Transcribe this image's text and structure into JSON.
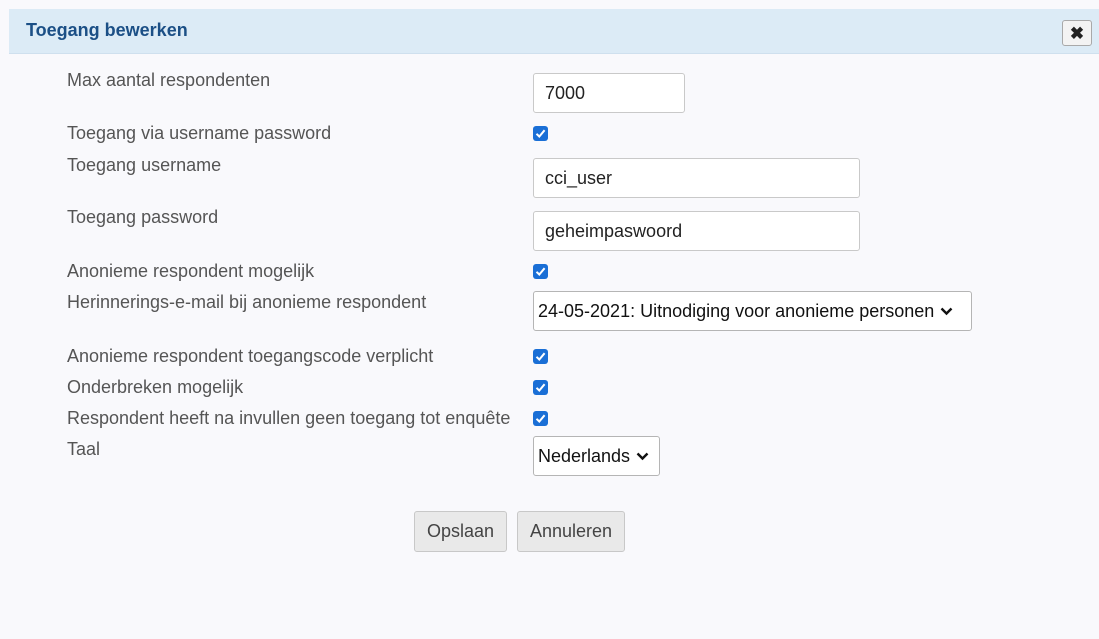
{
  "dialog": {
    "title": "Toegang bewerken",
    "close_icon": "close-icon"
  },
  "fields": {
    "max_respondents": {
      "label": "Max aantal respondenten",
      "value": "7000"
    },
    "access_userpass": {
      "label": "Toegang via username password",
      "checked": true
    },
    "username": {
      "label": "Toegang username",
      "value": "cci_user"
    },
    "password": {
      "label": "Toegang password",
      "value": "geheimpaswoord"
    },
    "anonymous_possible": {
      "label": "Anonieme respondent mogelijk",
      "checked": true
    },
    "reminder_email": {
      "label": "Herinnerings-e-mail bij anonieme respondent",
      "selected": "24-05-2021: Uitnodiging voor anonieme personen"
    },
    "anonymous_code_required": {
      "label": "Anonieme respondent toegangscode verplicht",
      "checked": true
    },
    "interrupt_possible": {
      "label": "Onderbreken mogelijk",
      "checked": true
    },
    "no_access_after": {
      "label": "Respondent heeft na invullen geen toegang tot enquête",
      "checked": true
    },
    "language": {
      "label": "Taal",
      "selected": "Nederlands"
    }
  },
  "buttons": {
    "save": "Opslaan",
    "cancel": "Annuleren"
  },
  "colors": {
    "title_bar": "#dcebf6",
    "title_text": "#1b4f86",
    "checkbox": "#1a6fd6"
  }
}
